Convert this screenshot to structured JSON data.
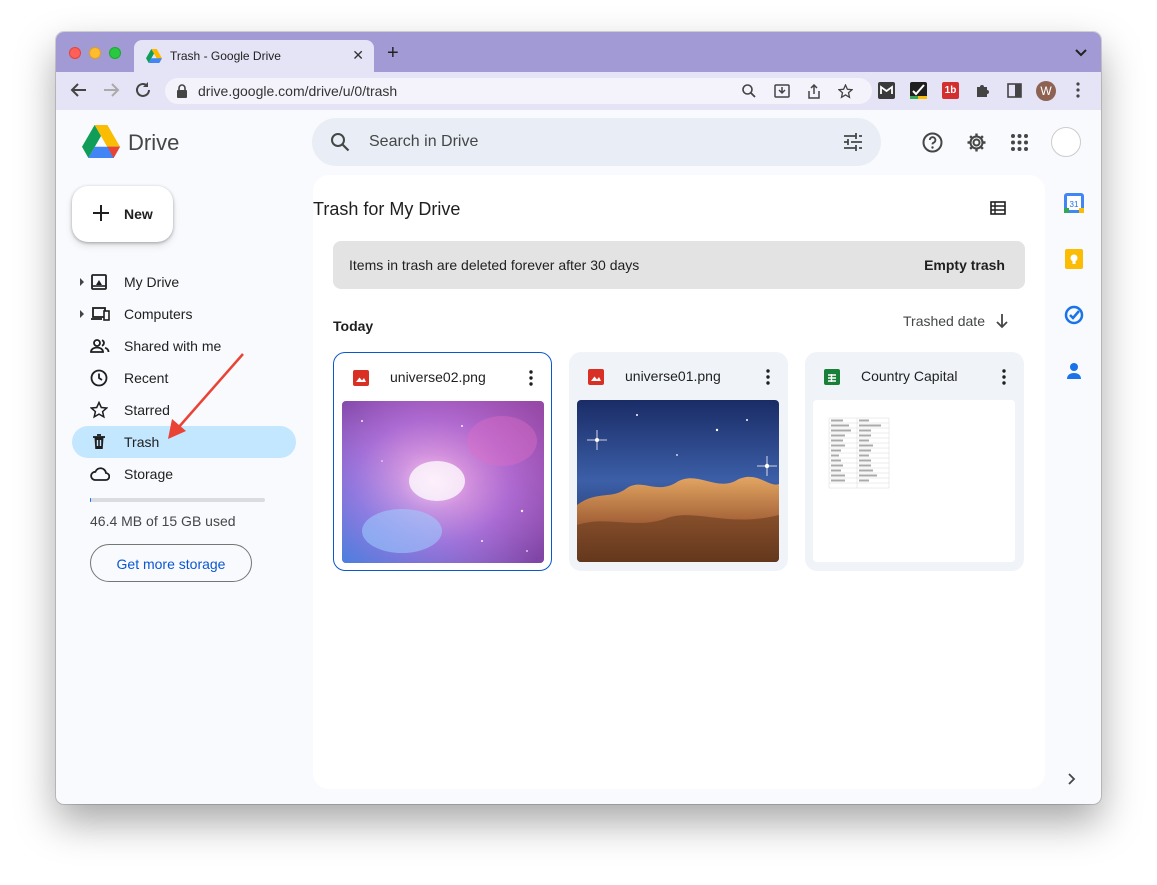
{
  "browser": {
    "tab_title": "Trash - Google Drive",
    "url": "drive.google.com/drive/u/0/trash",
    "profile_initial": "W"
  },
  "header": {
    "app_name": "Drive",
    "search_placeholder": "Search in Drive"
  },
  "sidebar": {
    "new_label": "New",
    "items": [
      {
        "label": "My Drive",
        "icon": "my-drive-icon",
        "expandable": true
      },
      {
        "label": "Computers",
        "icon": "computers-icon",
        "expandable": true
      },
      {
        "label": "Shared with me",
        "icon": "shared-icon",
        "expandable": false
      },
      {
        "label": "Recent",
        "icon": "clock-icon",
        "expandable": false
      },
      {
        "label": "Starred",
        "icon": "star-icon",
        "expandable": false
      },
      {
        "label": "Trash",
        "icon": "trash-icon",
        "expandable": false,
        "active": true
      },
      {
        "label": "Storage",
        "icon": "cloud-icon",
        "expandable": false
      }
    ],
    "storage_used_text": "46.4 MB of 15 GB used",
    "storage_used_fraction": 0.003,
    "get_storage_label": "Get more storage"
  },
  "main": {
    "title": "Trash for My Drive",
    "banner_text": "Items in trash are deleted forever after 30 days",
    "empty_trash_label": "Empty trash",
    "section_label": "Today",
    "sort_label": "Trashed date",
    "files": [
      {
        "name": "universe02.png",
        "type": "image",
        "selected": true
      },
      {
        "name": "universe01.png",
        "type": "image",
        "selected": false
      },
      {
        "name": "Country Capital",
        "type": "spreadsheet",
        "selected": false
      }
    ]
  },
  "colors": {
    "accent": "#0b57d0",
    "active_nav": "#c2e7ff",
    "image_icon": "#d93025",
    "sheets_icon": "#188038",
    "annotation_arrow": "#ea4335",
    "tab_strip": "#a19ad4"
  }
}
